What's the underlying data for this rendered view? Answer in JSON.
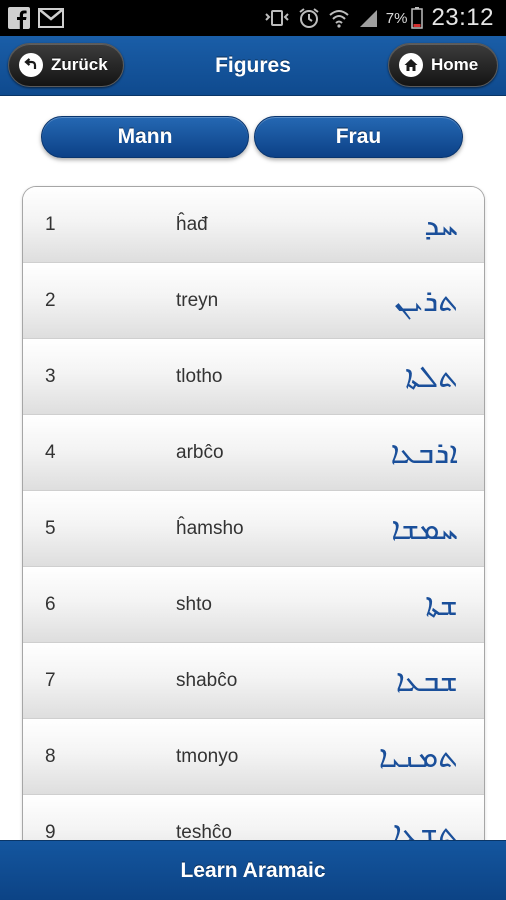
{
  "status_bar": {
    "battery_percent": "7%",
    "time": "23:12",
    "icons": [
      "facebook-icon",
      "gmail-icon",
      "vibrate-icon",
      "alarm-icon",
      "wifi-icon",
      "signal-icon",
      "battery-icon"
    ]
  },
  "header": {
    "title": "Figures",
    "back_label": "Zurück",
    "home_label": "Home"
  },
  "gender_tabs": [
    {
      "label": "Mann"
    },
    {
      "label": "Frau"
    }
  ],
  "numbers": [
    {
      "number": "1",
      "transliteration": "ĥađ",
      "syriac": "ܚܕ"
    },
    {
      "number": "2",
      "transliteration": "treyn",
      "syriac": "ܬܪܝܢ"
    },
    {
      "number": "3",
      "transliteration": "tlotho",
      "syriac": "ܬܠܬܐ"
    },
    {
      "number": "4",
      "transliteration": "arbĉo",
      "syriac": "ܐܪܒܥܐ"
    },
    {
      "number": "5",
      "transliteration": "ĥamsho",
      "syriac": "ܚܡܫܐ"
    },
    {
      "number": "6",
      "transliteration": "shto",
      "syriac": "ܫܬܐ"
    },
    {
      "number": "7",
      "transliteration": "shabĉo",
      "syriac": "ܫܒܥܐ"
    },
    {
      "number": "8",
      "transliteration": "tmonyo",
      "syriac": "ܬܡܢܝܐ"
    },
    {
      "number": "9",
      "transliteration": "teshĉo",
      "syriac": "ܬܫܥܐ"
    }
  ],
  "footer": {
    "title": "Learn Aramaic"
  },
  "colors": {
    "brand_blue": "#0f4a8e",
    "syriac_text": "#1a4f9a"
  }
}
